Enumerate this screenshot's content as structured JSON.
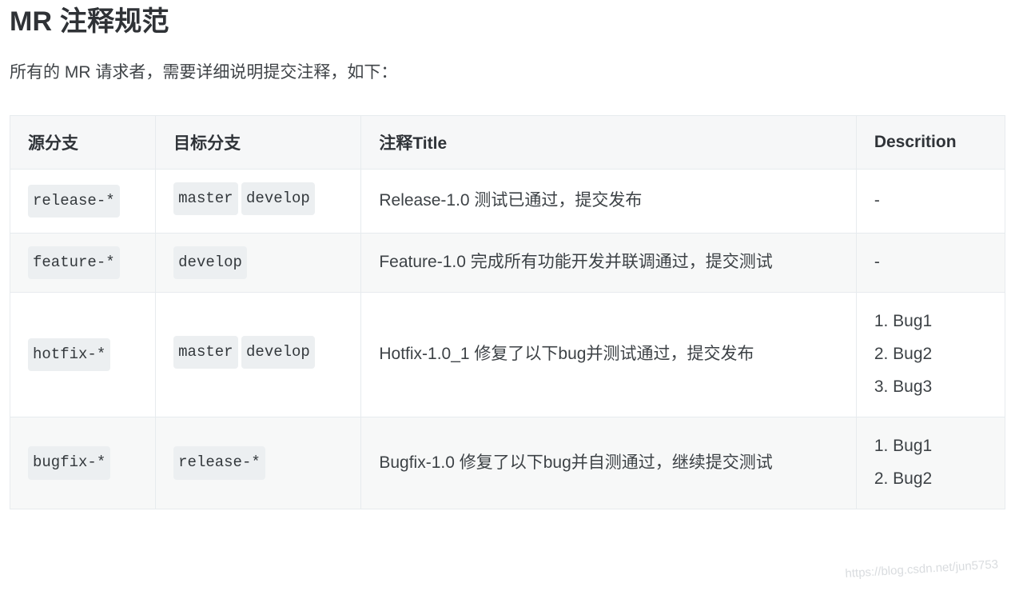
{
  "page": {
    "title": "MR 注释规范",
    "intro": "所有的 MR 请求者，需要详细说明提交注释，如下："
  },
  "table": {
    "headers": {
      "source": "源分支",
      "target": "目标分支",
      "title": "注释Title",
      "description": "Descrition"
    },
    "rows": [
      {
        "source": [
          "release-*"
        ],
        "target": [
          "master",
          "develop"
        ],
        "title": "Release-1.0 测试已通过，提交发布",
        "description_dash": "-",
        "description_items": []
      },
      {
        "source": [
          "feature-*"
        ],
        "target": [
          "develop"
        ],
        "title": "Feature-1.0 完成所有功能开发并联调通过，提交测试",
        "description_dash": "-",
        "description_items": []
      },
      {
        "source": [
          "hotfix-*"
        ],
        "target": [
          "master",
          "develop"
        ],
        "title": "Hotfix-1.0_1 修复了以下bug并测试通过，提交发布",
        "description_dash": "",
        "description_items": [
          "1. Bug1",
          "2. Bug2",
          "3. Bug3"
        ]
      },
      {
        "source": [
          "bugfix-*"
        ],
        "target": [
          "release-*"
        ],
        "title": "Bugfix-1.0 修复了以下bug并自测通过，继续提交测试",
        "description_dash": "",
        "description_items": [
          "1. Bug1",
          "2. Bug2"
        ]
      }
    ]
  },
  "watermark": {
    "text": "https://blog.csdn.net/jun5753"
  },
  "colors": {
    "header_bg": "#f6f7f8",
    "row_alt_bg": "#f7f8f8",
    "border": "#e7ebee",
    "text": "#3d4246",
    "chip_bg": "#eceff1",
    "watermark": "#d9dcdf"
  }
}
